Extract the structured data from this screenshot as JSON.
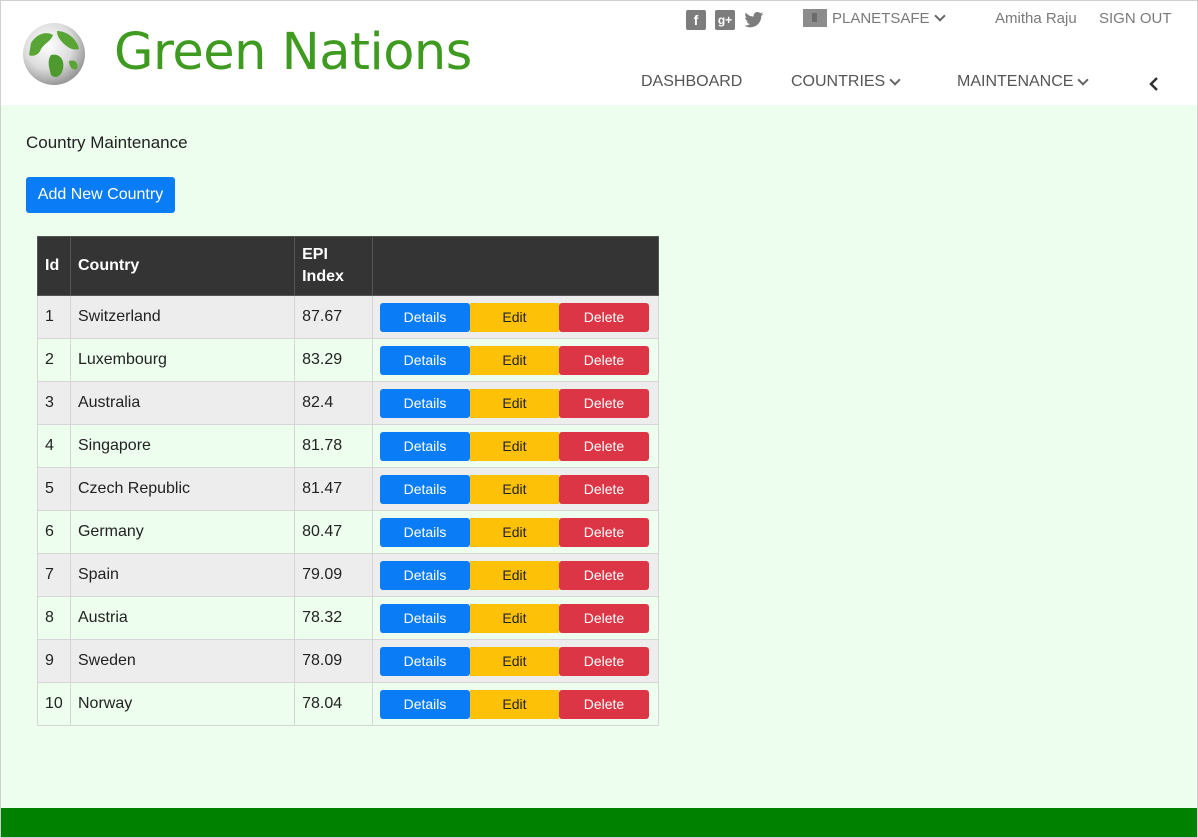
{
  "header": {
    "brand": "Green Nations",
    "social": [
      "facebook-icon",
      "google-plus-icon",
      "twitter-icon"
    ],
    "org_label": "PLANETSAFE",
    "user_name": "Amitha Raju",
    "signout_label": "SIGN OUT",
    "nav": [
      {
        "label": "DASHBOARD",
        "dropdown": false
      },
      {
        "label": "COUNTRIES",
        "dropdown": true
      },
      {
        "label": "MAINTENANCE",
        "dropdown": true
      }
    ]
  },
  "main": {
    "page_title": "Country Maintenance",
    "add_button": "Add New Country",
    "table": {
      "headers": [
        "Id",
        "Country",
        "EPI Index",
        ""
      ],
      "action_labels": {
        "details": "Details",
        "edit": "Edit",
        "delete": "Delete"
      },
      "rows": [
        {
          "id": "1",
          "country": "Switzerland",
          "epi": "87.67"
        },
        {
          "id": "2",
          "country": "Luxembourg",
          "epi": "83.29"
        },
        {
          "id": "3",
          "country": "Australia",
          "epi": "82.4"
        },
        {
          "id": "4",
          "country": "Singapore",
          "epi": "81.78"
        },
        {
          "id": "5",
          "country": "Czech Republic",
          "epi": "81.47"
        },
        {
          "id": "6",
          "country": "Germany",
          "epi": "80.47"
        },
        {
          "id": "7",
          "country": "Spain",
          "epi": "79.09"
        },
        {
          "id": "8",
          "country": "Austria",
          "epi": "78.32"
        },
        {
          "id": "9",
          "country": "Sweden",
          "epi": "78.09"
        },
        {
          "id": "10",
          "country": "Norway",
          "epi": "78.04"
        }
      ]
    }
  },
  "colors": {
    "brand_green": "#3f9a20",
    "content_bg": "#edfdee",
    "footer_green": "#008100",
    "primary_blue": "#0a7df6",
    "warning_yellow": "#fdc107",
    "danger_red": "#dc3545"
  }
}
